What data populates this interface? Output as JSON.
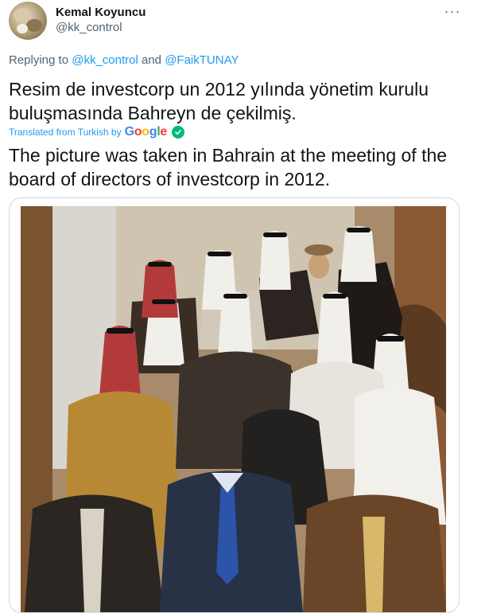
{
  "author": {
    "name": "Kemal Koyuncu",
    "handle": "@kk_control",
    "avatar_icon": "profile-avatar"
  },
  "more_icon": "more-horizontal-icon",
  "reply": {
    "prefix": "Replying to ",
    "user1": "@kk_control",
    "conjunction": " and ",
    "user2": "@FaikTUNAY"
  },
  "tweet": {
    "text": "Resim de investcorp un 2012 yılında yönetim kurulu buluşmasında Bahreyn de çekilmiş.",
    "translated_label": "Translated from Turkish by",
    "translation_provider": "Google",
    "translation": "The picture was taken in Bahrain at the meeting of the board of directors of investcorp in 2012."
  },
  "colors": {
    "link": "#1d9bf0",
    "secondary_text": "#536471",
    "verified_green": "#00ba7c"
  }
}
